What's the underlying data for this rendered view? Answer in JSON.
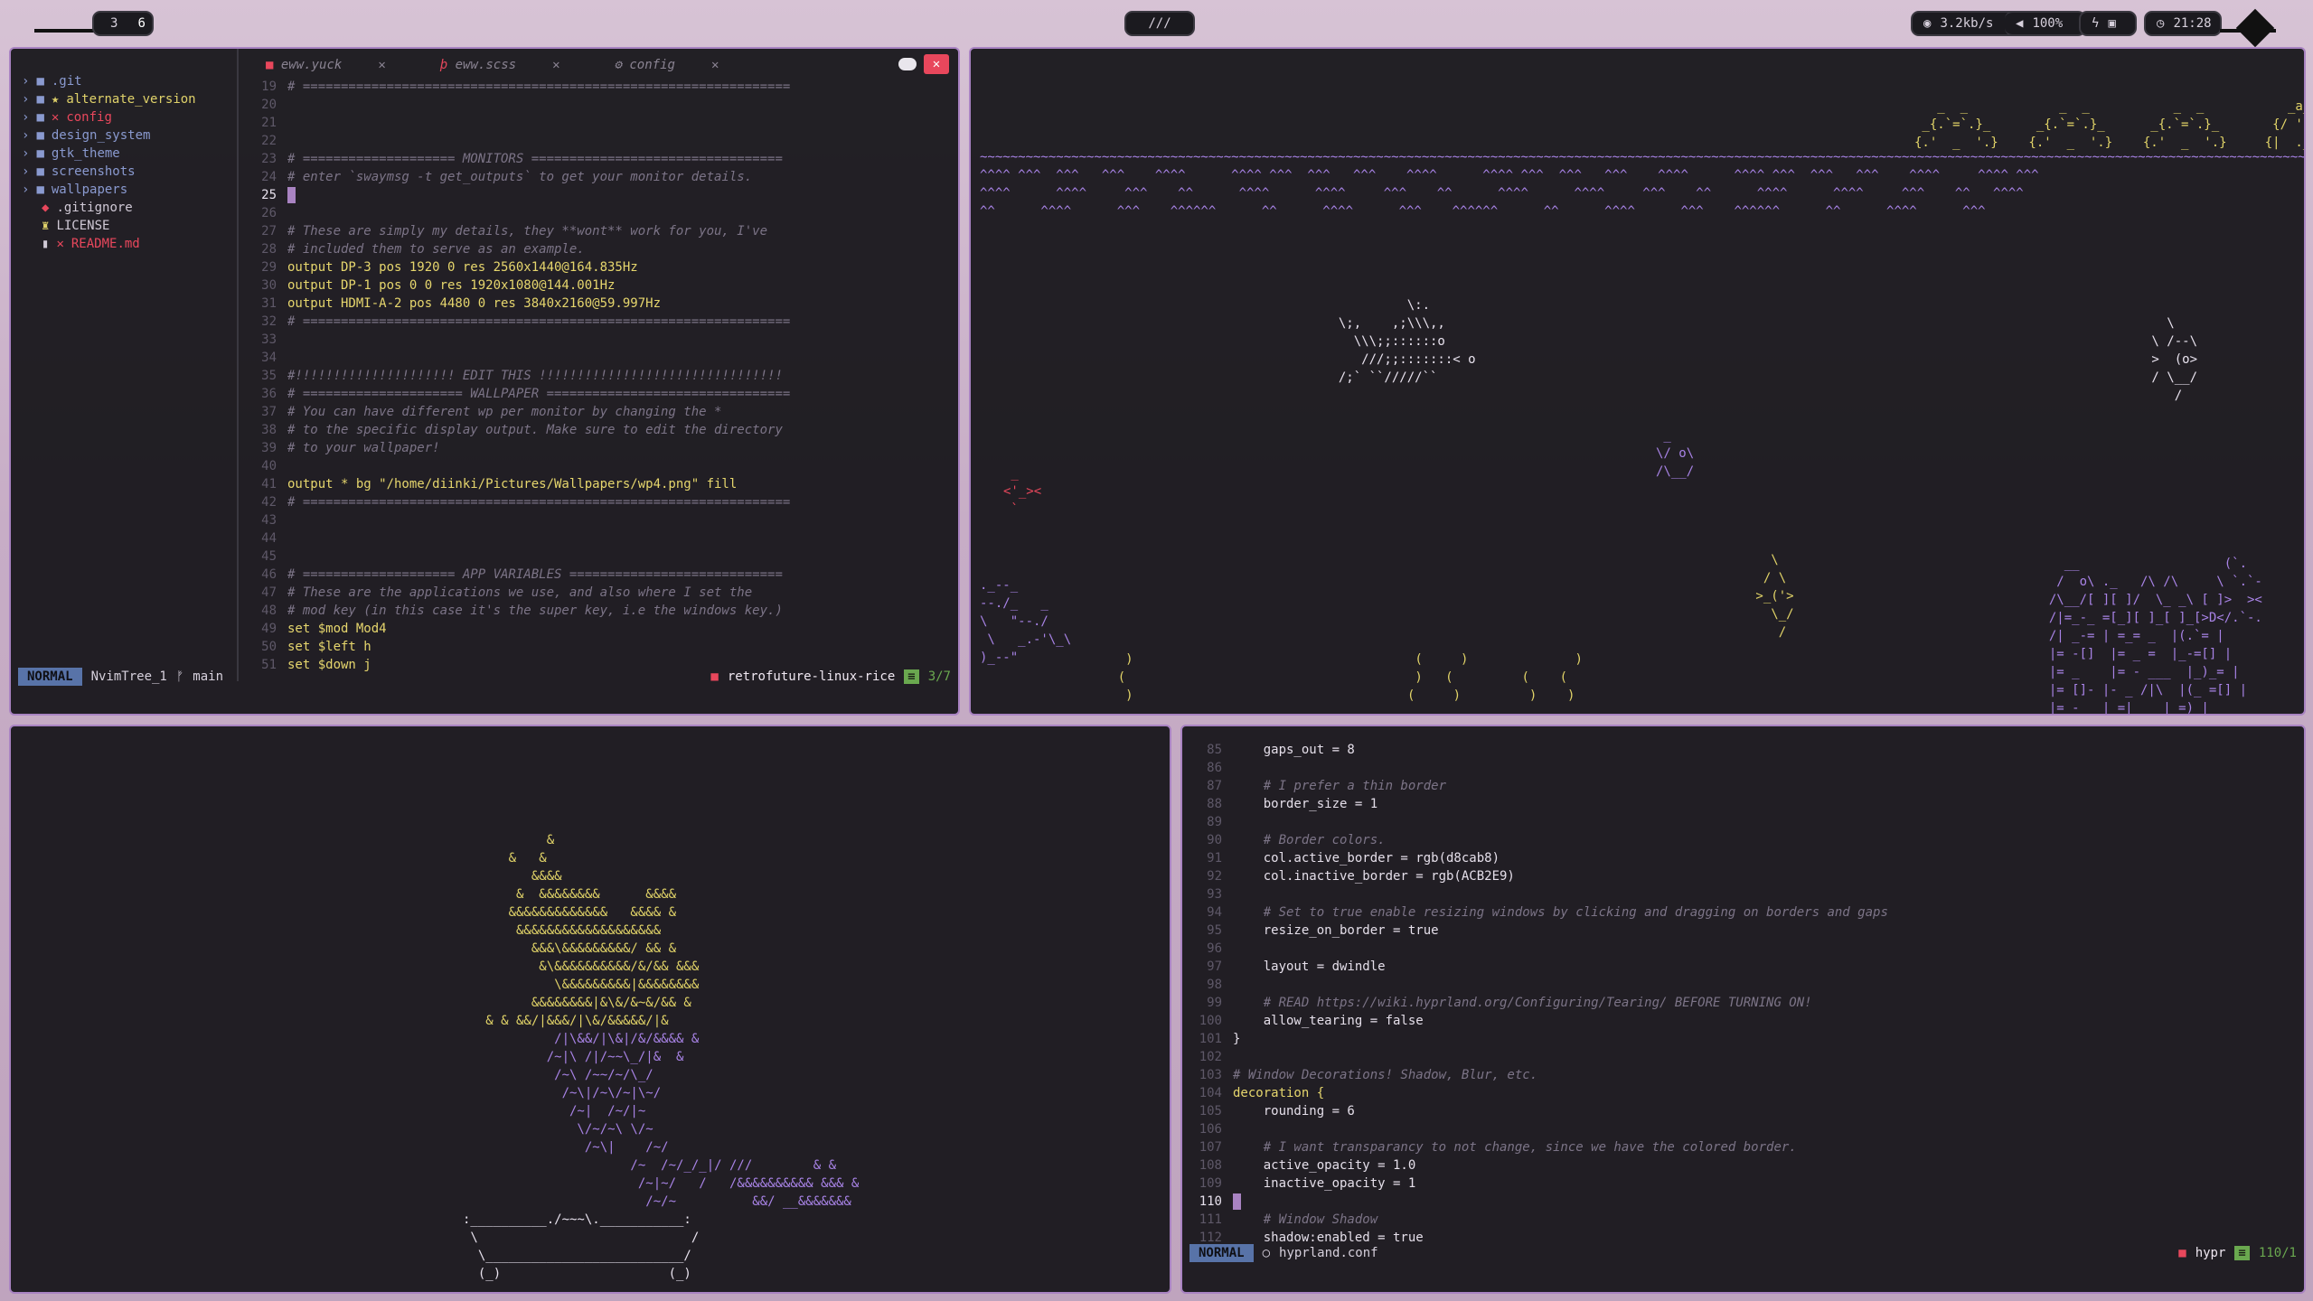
{
  "topbar": {
    "workspaces": [
      "3",
      "6"
    ],
    "center_label": "///",
    "network": "3.2kb/s",
    "volume": "100%",
    "clock": "21:28"
  },
  "top_left_window": {
    "tree": [
      {
        "label": ".git",
        "kind": "folder"
      },
      {
        "label": "alternate_version",
        "kind": "folder-mod"
      },
      {
        "label": "config",
        "kind": "folder-error"
      },
      {
        "label": "design_system",
        "kind": "folder"
      },
      {
        "label": "gtk_theme",
        "kind": "folder"
      },
      {
        "label": "screenshots",
        "kind": "folder"
      },
      {
        "label": "wallpapers",
        "kind": "folder"
      },
      {
        "label": ".gitignore",
        "kind": "file"
      },
      {
        "label": "LICENSE",
        "kind": "file"
      },
      {
        "label": "README.md",
        "kind": "file-error"
      }
    ],
    "tabs": [
      "eww.yuck",
      "eww.scss",
      "config"
    ],
    "code_lines": [
      {
        "n": "19",
        "t": "# ================================================================",
        "c": "cm"
      },
      {
        "n": "20",
        "t": "",
        "c": "cm"
      },
      {
        "n": "21",
        "t": "",
        "c": "cm"
      },
      {
        "n": "22",
        "t": "",
        "c": "cm"
      },
      {
        "n": "23",
        "t": "# ==================== MONITORS =================================",
        "c": "cm"
      },
      {
        "n": "24",
        "t": "# enter `swaymsg -t get_outputs` to get your monitor details.",
        "c": "cm"
      },
      {
        "n": "25",
        "t": "",
        "c": "cur"
      },
      {
        "n": "26",
        "t": "",
        "c": "cm"
      },
      {
        "n": "27",
        "t": "# These are simply my details, they **wont** work for you, I've",
        "c": "cm"
      },
      {
        "n": "28",
        "t": "# included them to serve as an example.",
        "c": "cm"
      },
      {
        "n": "29",
        "t": "output DP-3 pos 1920 0 res 2560x1440@164.835Hz",
        "c": "out"
      },
      {
        "n": "30",
        "t": "output DP-1 pos 0 0 res 1920x1080@144.001Hz",
        "c": "out"
      },
      {
        "n": "31",
        "t": "output HDMI-A-2 pos 4480 0 res 3840x2160@59.997Hz",
        "c": "out"
      },
      {
        "n": "32",
        "t": "# ================================================================",
        "c": "cm"
      },
      {
        "n": "33",
        "t": "",
        "c": "cm"
      },
      {
        "n": "34",
        "t": "",
        "c": "cm"
      },
      {
        "n": "35",
        "t": "#!!!!!!!!!!!!!!!!!!!!! EDIT THIS !!!!!!!!!!!!!!!!!!!!!!!!!!!!!!!!",
        "c": "cm"
      },
      {
        "n": "36",
        "t": "# ===================== WALLPAPER ================================",
        "c": "cm"
      },
      {
        "n": "37",
        "t": "# You can have different wp per monitor by changing the *",
        "c": "cm"
      },
      {
        "n": "38",
        "t": "# to the specific display output. Make sure to edit the directory",
        "c": "cm"
      },
      {
        "n": "39",
        "t": "# to your wallpaper!",
        "c": "cm"
      },
      {
        "n": "40",
        "t": "",
        "c": "cm"
      },
      {
        "n": "41",
        "t": "output * bg \"/home/diinki/Pictures/Wallpapers/wp4.png\" fill",
        "c": "bg"
      },
      {
        "n": "42",
        "t": "# ================================================================",
        "c": "cm"
      },
      {
        "n": "43",
        "t": "",
        "c": "cm"
      },
      {
        "n": "44",
        "t": "",
        "c": "cm"
      },
      {
        "n": "45",
        "t": "",
        "c": "cm"
      },
      {
        "n": "46",
        "t": "# ==================== APP VARIABLES ============================",
        "c": "cm"
      },
      {
        "n": "47",
        "t": "# These are the applications we use, and also where I set the",
        "c": "cm"
      },
      {
        "n": "48",
        "t": "# mod key (in this case it's the super key, i.e the windows key.)",
        "c": "cm"
      },
      {
        "n": "49",
        "t": "set $mod Mod4",
        "c": "set"
      },
      {
        "n": "50",
        "t": "set $left h",
        "c": "set"
      },
      {
        "n": "51",
        "t": "set $down j",
        "c": "set"
      }
    ],
    "status": {
      "mode": "NORMAL",
      "buffer": "NvimTree_1",
      "branch": "main",
      "project": "retrofuture-linux-rice",
      "pos": "3/7"
    }
  },
  "bottom_right_window": {
    "code_lines": [
      {
        "n": "85",
        "t": "    gaps_out = 8",
        "c": "wh"
      },
      {
        "n": "86",
        "t": "",
        "c": "cm"
      },
      {
        "n": "87",
        "t": "    # I prefer a thin border",
        "c": "cm"
      },
      {
        "n": "88",
        "t": "    border_size = 1",
        "c": "wh"
      },
      {
        "n": "89",
        "t": "",
        "c": "cm"
      },
      {
        "n": "90",
        "t": "    # Border colors.",
        "c": "cm"
      },
      {
        "n": "91",
        "t": "    col.active_border = rgb(d8cab8)",
        "c": "wh"
      },
      {
        "n": "92",
        "t": "    col.inactive_border = rgb(ACB2E9)",
        "c": "wh"
      },
      {
        "n": "93",
        "t": "",
        "c": "cm"
      },
      {
        "n": "94",
        "t": "    # Set to true enable resizing windows by clicking and dragging on borders and gaps",
        "c": "cm"
      },
      {
        "n": "95",
        "t": "    resize_on_border = true",
        "c": "wh"
      },
      {
        "n": "96",
        "t": "",
        "c": "cm"
      },
      {
        "n": "97",
        "t": "    layout = dwindle",
        "c": "wh"
      },
      {
        "n": "98",
        "t": "",
        "c": "cm"
      },
      {
        "n": "99",
        "t": "    # READ https://wiki.hyprland.org/Configuring/Tearing/ BEFORE TURNING ON!",
        "c": "cm"
      },
      {
        "n": "100",
        "t": "    allow_tearing = false",
        "c": "wh"
      },
      {
        "n": "101",
        "t": "}",
        "c": "wh"
      },
      {
        "n": "102",
        "t": "",
        "c": "cm"
      },
      {
        "n": "103",
        "t": "# Window Decorations! Shadow, Blur, etc.",
        "c": "cm"
      },
      {
        "n": "104",
        "t": "decoration {",
        "c": "kw"
      },
      {
        "n": "105",
        "t": "    rounding = 6",
        "c": "wh"
      },
      {
        "n": "106",
        "t": "",
        "c": "cm"
      },
      {
        "n": "107",
        "t": "    # I want transparancy to not change, since we have the colored border.",
        "c": "cm"
      },
      {
        "n": "108",
        "t": "    active_opacity = 1.0",
        "c": "wh"
      },
      {
        "n": "109",
        "t": "    inactive_opacity = 1",
        "c": "wh"
      },
      {
        "n": "110",
        "t": "",
        "c": "cur"
      },
      {
        "n": "111",
        "t": "    # Window Shadow",
        "c": "cm"
      },
      {
        "n": "112",
        "t": "    shadow:enabled = true",
        "c": "wh"
      }
    ],
    "status": {
      "mode": "NORMAL",
      "file": "hyprland.conf",
      "project": "hypr",
      "pos": "110/1"
    }
  },
  "colors": {
    "accent": "#a983c2",
    "mode": "#5873a8",
    "error": "#e8475c",
    "comment": "#7c7487",
    "keyword": "#e6d66d"
  }
}
